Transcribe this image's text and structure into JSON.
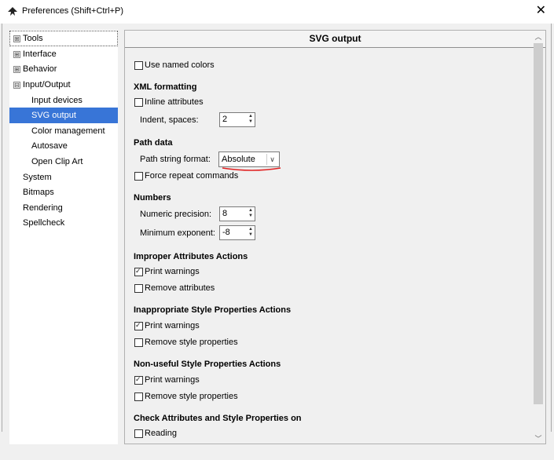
{
  "window": {
    "title": "Preferences (Shift+Ctrl+P)",
    "close_glyph": "✕",
    "icon": "inkscape-icon"
  },
  "sidebar": {
    "items": [
      {
        "label": "Tools",
        "expander": "⊞"
      },
      {
        "label": "Interface",
        "expander": "⊞"
      },
      {
        "label": "Behavior",
        "expander": "⊞"
      },
      {
        "label": "Input/Output",
        "expander": "⊟"
      },
      {
        "label": "Input devices"
      },
      {
        "label": "SVG output"
      },
      {
        "label": "Color management"
      },
      {
        "label": "Autosave"
      },
      {
        "label": "Open Clip Art"
      },
      {
        "label": "System"
      },
      {
        "label": "Bitmaps"
      },
      {
        "label": "Rendering"
      },
      {
        "label": "Spellcheck"
      }
    ],
    "selected": "SVG output"
  },
  "panel": {
    "title": "SVG output",
    "use_named_colors": {
      "label": "Use named colors",
      "checked": false
    },
    "xml": {
      "heading": "XML formatting",
      "inline_attributes": {
        "label": "Inline attributes",
        "checked": false
      },
      "indent_label": "Indent, spaces:",
      "indent_value": "2"
    },
    "path": {
      "heading": "Path data",
      "format_label": "Path string format:",
      "format_value": "Absolute",
      "force_repeat": {
        "label": "Force repeat commands",
        "checked": false
      }
    },
    "numbers": {
      "heading": "Numbers",
      "precision_label": "Numeric precision:",
      "precision_value": "8",
      "min_exp_label": "Minimum exponent:",
      "min_exp_value": "-8"
    },
    "improper": {
      "heading": "Improper Attributes Actions",
      "print_warnings": {
        "label": "Print warnings",
        "checked": true
      },
      "remove": {
        "label": "Remove attributes",
        "checked": false
      }
    },
    "inappropriate": {
      "heading": "Inappropriate Style Properties Actions",
      "print_warnings": {
        "label": "Print warnings",
        "checked": true
      },
      "remove": {
        "label": "Remove style properties",
        "checked": false
      }
    },
    "nonuseful": {
      "heading": "Non-useful Style Properties Actions",
      "print_warnings": {
        "label": "Print warnings",
        "checked": true
      },
      "remove": {
        "label": "Remove style properties",
        "checked": false
      }
    },
    "check": {
      "heading": "Check Attributes and Style Properties on",
      "reading": {
        "label": "Reading",
        "checked": false
      }
    }
  },
  "colors": {
    "selection": "#3875d7",
    "annotation": "#e02020"
  }
}
